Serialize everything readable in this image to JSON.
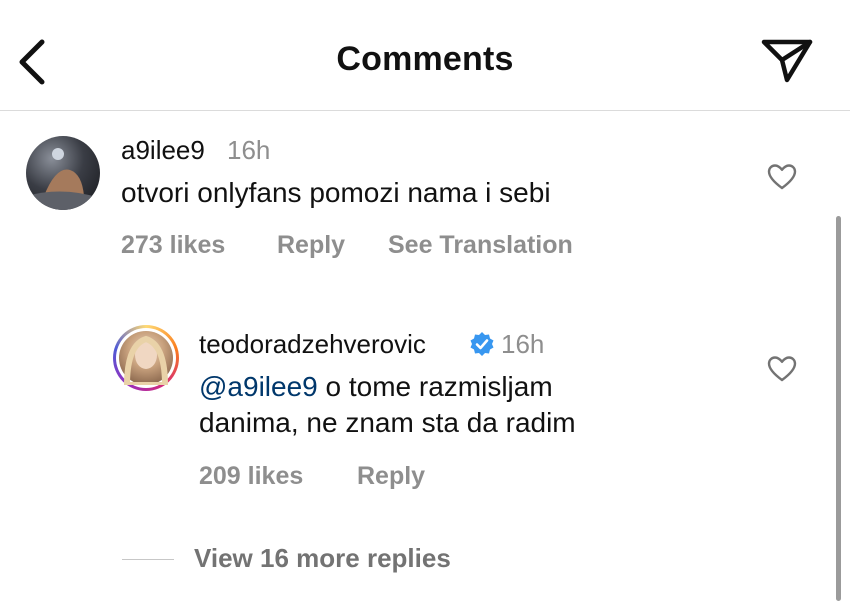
{
  "header": {
    "title": "Comments",
    "back_icon": "chevron-left-icon",
    "send_icon": "paper-plane-icon"
  },
  "comments": [
    {
      "username": "a9ilee9",
      "time": "16h",
      "text": "otvori onlyfans pomozi nama i sebi",
      "likes": "273 likes",
      "reply_label": "Reply",
      "translate_label": "See Translation"
    }
  ],
  "reply": {
    "username": "teodoradzehverovic",
    "verified": true,
    "time": "16h",
    "mention": "@a9ilee9",
    "text_line1": " o tome razmisljam",
    "text_line2": "danima, ne znam sta da radim",
    "likes": "209 likes",
    "reply_label": "Reply"
  },
  "view_more": "View 16 more replies",
  "colors": {
    "muted": "#8e8e8e",
    "mention": "#00376b",
    "verified": "#3897f0"
  }
}
